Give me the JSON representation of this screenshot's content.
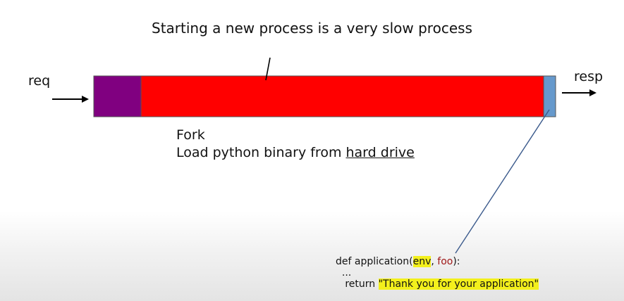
{
  "title": "Starting a new process is a very slow process",
  "labels": {
    "request": "req",
    "response": "resp"
  },
  "timeline": {
    "segments": [
      {
        "role": "startup",
        "color": "#800080"
      },
      {
        "role": "process-startup",
        "color": "#ff0000"
      },
      {
        "role": "application-call",
        "color": "#6699cc"
      }
    ]
  },
  "notes": {
    "line1": "Fork",
    "line2_prefix": "Load python binary from ",
    "line2_underlined": "hard drive"
  },
  "code": {
    "line1_prefix": "def application(",
    "arg1": "env",
    "sep": ", ",
    "arg2": "foo",
    "line1_suffix": "):",
    "line2": "  ...",
    "line3_prefix": "   return ",
    "return_value": "\"Thank you for your application\""
  },
  "colors": {
    "highlight": "#f3f01c",
    "arg_color": "#a01818"
  }
}
